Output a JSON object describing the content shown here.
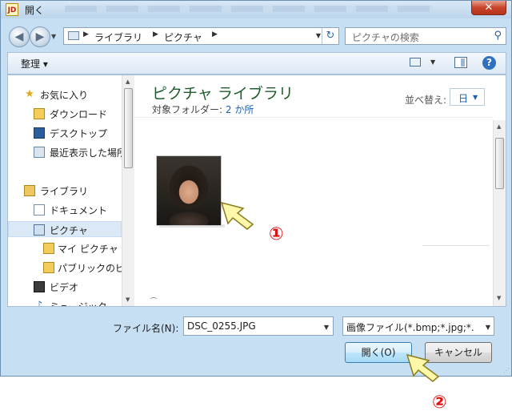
{
  "window": {
    "title": "開く",
    "close_label": "✕"
  },
  "nav": {
    "breadcrumb": [
      "ライブラリ",
      "ピクチャ"
    ],
    "search_placeholder": "ピクチャの検索"
  },
  "toolbar": {
    "organize_label": "整理 ▾"
  },
  "sidebar": {
    "items": [
      {
        "label": "お気に入り",
        "icon": "star-icon"
      },
      {
        "label": "ダウンロード",
        "icon": "download-folder-icon"
      },
      {
        "label": "デスクトップ",
        "icon": "desktop-icon"
      },
      {
        "label": "最近表示した場所",
        "icon": "recent-places-icon"
      },
      {
        "label": "ライブラリ",
        "icon": "library-icon"
      },
      {
        "label": "ドキュメント",
        "icon": "document-icon"
      },
      {
        "label": "ピクチャ",
        "icon": "pictures-icon"
      },
      {
        "label": "マイ ピクチャ",
        "icon": "folder-icon"
      },
      {
        "label": "パブリックのピ",
        "icon": "folder-icon"
      },
      {
        "label": "ビデオ",
        "icon": "video-icon"
      },
      {
        "label": "ミュージック",
        "icon": "music-icon"
      }
    ],
    "selected": "ピクチャ"
  },
  "pane": {
    "title": "ピクチャ ライブラリ",
    "subtitle_prefix": "対象フォルダー:",
    "subtitle_link": "2 か所",
    "sort_label": "並べ替え:",
    "sort_value": "日"
  },
  "annotations": {
    "one": "①",
    "two": "②"
  },
  "bottom": {
    "filename_label": "ファイル名(N):",
    "filename_value": "DSC_0255.JPG",
    "filetype_value": "画像ファイル(*.bmp;*.jpg;*.",
    "open_label": "開く(O)",
    "cancel_label": "キャンセル"
  },
  "colors": {
    "chrome": "#c7dff3",
    "accent_title": "#1e5c2e",
    "link": "#1a5fb4",
    "annotation": "#e01010"
  }
}
